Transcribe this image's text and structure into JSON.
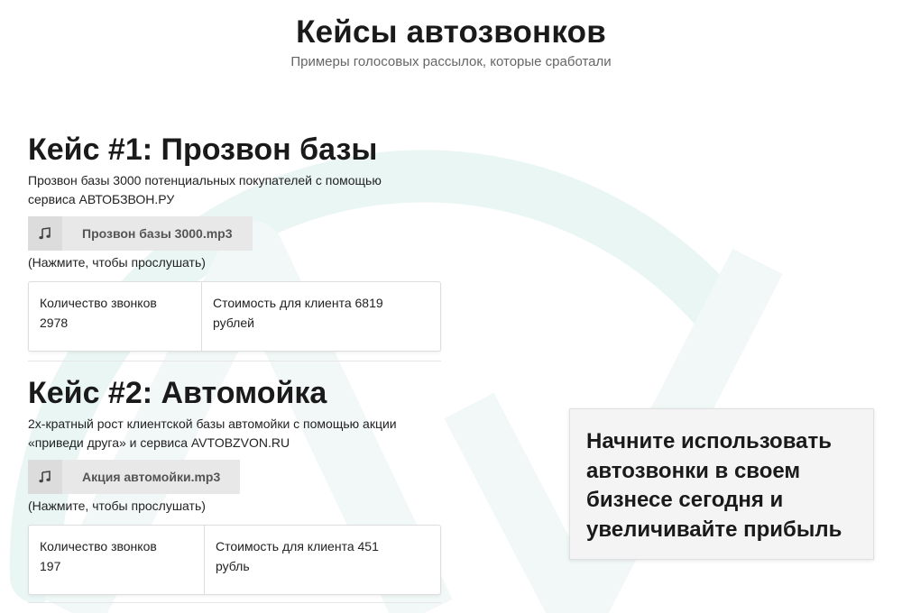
{
  "header": {
    "title": "Кейсы автозвонков",
    "subtitle": "Примеры голосовых рассылок, которые сработали"
  },
  "cases": [
    {
      "title": "Кейс #1: Прозвон базы",
      "description": "Прозвон базы 3000 потенциальных покупателей с помощью сервиса АВТОБЗВОН.РУ",
      "audio": {
        "icon": "music-note-icon",
        "filename": "Прозвон базы 3000.mp3"
      },
      "hint": "(Нажмите, чтобы прослушать)",
      "stats": {
        "calls_label": "Количество звонков",
        "calls_value": "2978",
        "cost_label": "Стоимость для клиента 6819",
        "cost_unit": "рублей"
      }
    },
    {
      "title": "Кейс #2: Автомойка",
      "description": "2х-кратный рост клиентской базы автомойки с помощью акции «приведи друга» и сервиса AVTOBZVON.RU",
      "audio": {
        "icon": "music-note-icon",
        "filename": "Акция автомойки.mp3"
      },
      "hint": "(Нажмите, чтобы прослушать)",
      "stats": {
        "calls_label": "Количество звонков",
        "calls_value": "197",
        "cost_label": "Стоимость для клиента 451",
        "cost_unit": "рубль"
      }
    }
  ],
  "cta": {
    "text": "Начните использовать автозвонки в своем бизнесе сегодня и увеличивайте прибыль"
  },
  "colors": {
    "watermark": "#eaf6f4",
    "audio_bg": "#e8e8e8",
    "cta_bg": "#f4f4f4"
  }
}
